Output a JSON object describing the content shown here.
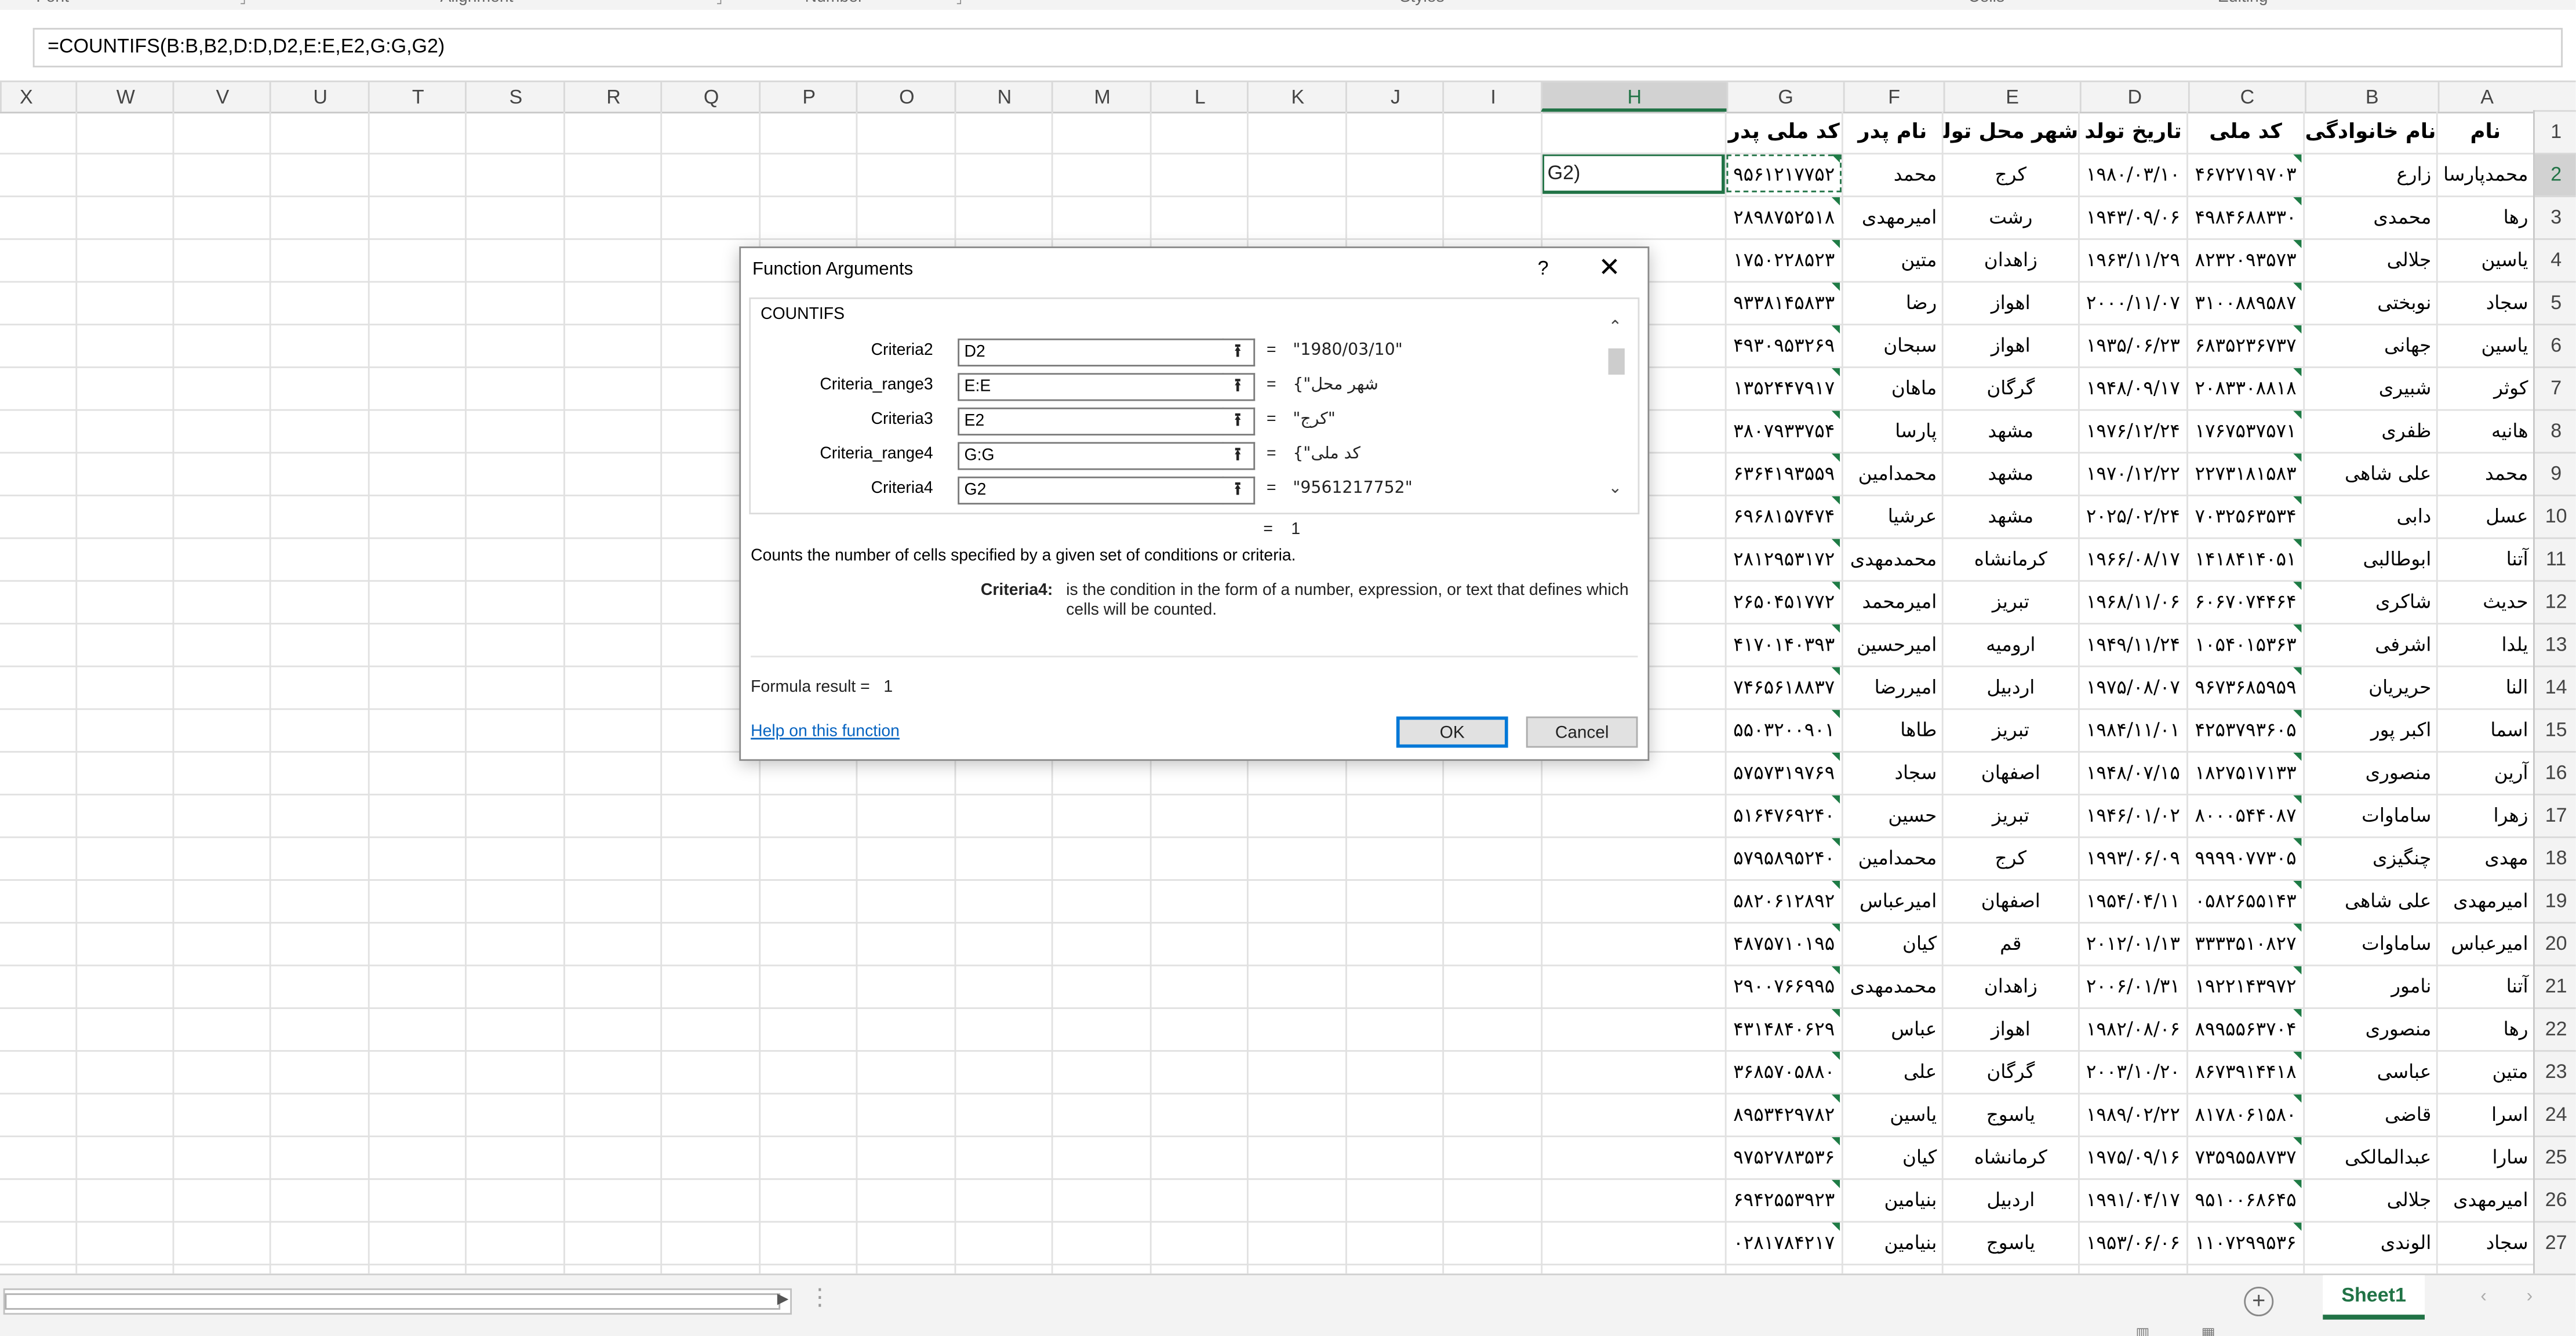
{
  "ribbon": {
    "groups": [
      "Font",
      "Alignment",
      "Number",
      "Styles",
      "Cells",
      "Editing"
    ]
  },
  "formula_bar": {
    "formula": "=COUNTIFS(B:B,B2,D:D,D2,E:E,E2,G:G,G2)"
  },
  "columns": [
    "X",
    "W",
    "V",
    "U",
    "T",
    "S",
    "R",
    "Q",
    "P",
    "O",
    "N",
    "M",
    "L",
    "K",
    "J",
    "I",
    "H",
    "G",
    "F",
    "E",
    "D",
    "C",
    "B",
    "A"
  ],
  "selected_column": "H",
  "selected_row": "2",
  "row_numbers": [
    "1",
    "2",
    "3",
    "4",
    "5",
    "6",
    "7",
    "8",
    "9",
    "10",
    "11",
    "12",
    "13",
    "14",
    "15",
    "16",
    "17",
    "18",
    "19",
    "20",
    "21",
    "22",
    "23",
    "24",
    "25",
    "26",
    "27"
  ],
  "headers": {
    "A": "نام",
    "B": "نام خانوادگی",
    "C": "کد ملی",
    "D": "تاریخ تولد",
    "E": "شهر محل تولد",
    "F": "نام پدر",
    "G": "کد ملی پدر"
  },
  "active_cell": {
    "ref": "H2",
    "text": "G2)"
  },
  "rows": [
    {
      "A": "محمدپارسا",
      "B": "زارع",
      "C": "۴۶۷۲۷۱۹۷۰۳",
      "D": "۱۹۸۰/۰۳/۱۰",
      "E": "کرج",
      "F": "محمد",
      "G": "۹۵۶۱۲۱۷۷۵۲"
    },
    {
      "A": "رها",
      "B": "محمدی",
      "C": "۴۹۸۴۶۸۸۳۳۰",
      "D": "۱۹۴۳/۰۹/۰۶",
      "E": "رشت",
      "F": "امیرمهدی",
      "G": "۲۸۹۸۷۵۲۵۱۸"
    },
    {
      "A": "یاسین",
      "B": "جلالی",
      "C": "۸۲۳۲۰۹۳۵۷۳",
      "D": "۱۹۶۳/۱۱/۲۹",
      "E": "زاهدان",
      "F": "متین",
      "G": "۱۷۵۰۲۲۸۵۲۳"
    },
    {
      "A": "سجاد",
      "B": "نوبختی",
      "C": "۳۱۰۰۸۸۹۵۸۷",
      "D": "۲۰۰۰/۱۱/۰۷",
      "E": "اهواز",
      "F": "رضا",
      "G": "۹۳۳۸۱۴۵۸۳۳"
    },
    {
      "A": "یاسین",
      "B": "جهانی",
      "C": "۶۸۳۵۲۳۶۷۳۷",
      "D": "۱۹۳۵/۰۶/۲۳",
      "E": "اهواز",
      "F": "سبحان",
      "G": "۴۹۳۰۹۵۳۲۶۹"
    },
    {
      "A": "کوثر",
      "B": "شبیری",
      "C": "۲۰۸۳۳۰۸۸۱۸",
      "D": "۱۹۴۸/۰۹/۱۷",
      "E": "گرگان",
      "F": "ماهان",
      "G": "۱۳۵۲۴۴۷۹۱۷"
    },
    {
      "A": "هانیه",
      "B": "ظفری",
      "C": "۱۷۶۷۵۳۷۵۷۱",
      "D": "۱۹۷۶/۱۲/۲۴",
      "E": "مشهد",
      "F": "پارسا",
      "G": "۳۸۰۷۹۳۳۷۵۴"
    },
    {
      "A": "محمد",
      "B": "علی شاهی",
      "C": "۲۲۷۳۱۸۱۵۸۳",
      "D": "۱۹۷۰/۱۲/۲۲",
      "E": "مشهد",
      "F": "محمدامین",
      "G": "۶۳۶۴۱۹۳۵۵۹"
    },
    {
      "A": "عسل",
      "B": "دابی",
      "C": "۷۰۳۲۵۶۳۵۳۴",
      "D": "۲۰۲۵/۰۲/۲۴",
      "E": "مشهد",
      "F": "عرشیا",
      "G": "۶۹۶۸۱۵۷۴۷۴"
    },
    {
      "A": "آتنا",
      "B": "ابوطالبی",
      "C": "۱۴۱۸۴۱۴۰۵۱",
      "D": "۱۹۶۶/۰۸/۱۷",
      "E": "کرمانشاه",
      "F": "محمدمهدی",
      "G": "۲۸۱۲۹۵۳۱۷۲"
    },
    {
      "A": "حدیث",
      "B": "شاکری",
      "C": "۶۰۶۷۰۷۴۴۶۴",
      "D": "۱۹۶۸/۱۱/۰۶",
      "E": "تبریز",
      "F": "امیرمحمد",
      "G": "۲۶۵۰۴۵۱۷۷۲"
    },
    {
      "A": "یلدا",
      "B": "اشرفی",
      "C": "۱۰۵۴۰۱۵۳۶۳",
      "D": "۱۹۴۹/۱۱/۲۴",
      "E": "ارومیه",
      "F": "امیرحسین",
      "G": "۴۱۷۰۱۴۰۳۹۳"
    },
    {
      "A": "النا",
      "B": "حریریان",
      "C": "۹۶۷۳۶۸۵۹۵۹",
      "D": "۱۹۷۵/۰۸/۰۷",
      "E": "اردبیل",
      "F": "امیررضا",
      "G": "۷۴۶۵۶۱۸۸۳۷"
    },
    {
      "A": "اسما",
      "B": "اکبر پور",
      "C": "۴۲۵۳۷۹۳۶۰۵",
      "D": "۱۹۸۴/۱۱/۰۱",
      "E": "تبریز",
      "F": "طاها",
      "G": "۵۵۰۳۲۰۰۹۰۱"
    },
    {
      "A": "آرین",
      "B": "منصوری",
      "C": "۱۸۲۷۵۱۷۱۳۳",
      "D": "۱۹۴۸/۰۷/۱۵",
      "E": "اصفهان",
      "F": "سجاد",
      "G": "۵۷۵۷۳۱۹۷۶۹"
    },
    {
      "A": "زهرا",
      "B": "ساماوات",
      "C": "۸۰۰۰۵۴۴۰۸۷",
      "D": "۱۹۴۶/۰۱/۰۲",
      "E": "تبریز",
      "F": "حسین",
      "G": "۵۱۶۴۷۶۹۲۴۰"
    },
    {
      "A": "مهدی",
      "B": "چنگیزی",
      "C": "۹۹۹۹۰۷۷۳۰۵",
      "D": "۱۹۹۳/۰۶/۰۹",
      "E": "کرج",
      "F": "محمدامین",
      "G": "۵۷۹۵۸۹۵۲۴۰"
    },
    {
      "A": "امیرمهدی",
      "B": "علی شاهی",
      "C": "۰۵۸۲۶۵۵۱۴۳",
      "D": "۱۹۵۴/۰۴/۱۱",
      "E": "اصفهان",
      "F": "امیرعباس",
      "G": "۵۸۲۰۶۱۲۸۹۲"
    },
    {
      "A": "امیرعباس",
      "B": "ساماوات",
      "C": "۳۳۳۳۵۱۰۸۲۷",
      "D": "۲۰۱۲/۰۱/۱۳",
      "E": "قم",
      "F": "کیان",
      "G": "۴۸۷۵۷۱۰۱۹۵"
    },
    {
      "A": "آتنا",
      "B": "نامور",
      "C": "۱۹۲۲۱۴۳۹۷۲",
      "D": "۲۰۰۶/۰۱/۳۱",
      "E": "زاهدان",
      "F": "محمدمهدی",
      "G": "۲۹۰۰۷۶۶۹۹۵"
    },
    {
      "A": "رها",
      "B": "منصوری",
      "C": "۸۹۹۵۵۶۳۷۰۴",
      "D": "۱۹۸۲/۰۸/۰۶",
      "E": "اهواز",
      "F": "عباس",
      "G": "۴۳۱۴۸۴۰۶۲۹"
    },
    {
      "A": "متین",
      "B": "عباسی",
      "C": "۸۶۷۳۹۱۴۴۱۸",
      "D": "۲۰۰۳/۱۰/۲۰",
      "E": "گرگان",
      "F": "علی",
      "G": "۳۶۸۵۷۰۵۸۸۰"
    },
    {
      "A": "اسرا",
      "B": "قاضی",
      "C": "۸۱۷۸۰۶۱۵۸۰",
      "D": "۱۹۸۹/۰۲/۲۲",
      "E": "یاسوج",
      "F": "یاسین",
      "G": "۸۹۵۳۴۲۹۷۸۲"
    },
    {
      "A": "سارا",
      "B": "عبدالمالکی",
      "C": "۷۳۵۹۵۵۸۷۳۷",
      "D": "۱۹۷۵/۰۹/۱۶",
      "E": "کرمانشاه",
      "F": "کیان",
      "G": "۹۷۵۲۷۸۳۵۳۶"
    },
    {
      "A": "امیرمهدی",
      "B": "جلالی",
      "C": "۹۵۱۰۰۶۸۶۴۵",
      "D": "۱۹۹۱/۰۴/۱۷",
      "E": "اردبیل",
      "F": "بنیامین",
      "G": "۶۹۴۲۵۵۳۹۲۳"
    },
    {
      "A": "سجاد",
      "B": "الوندی",
      "C": "۱۱۰۷۲۹۹۵۳۶",
      "D": "۱۹۵۳/۰۶/۰۶",
      "E": "یاسوج",
      "F": "بنیامین",
      "G": "۰۲۸۱۷۸۴۲۱۷"
    }
  ],
  "dialog": {
    "title": "Function Arguments",
    "help_glyph": "?",
    "close_glyph": "✕",
    "function_name": "COUNTIFS",
    "args": [
      {
        "label": "Criteria2",
        "value": "D2",
        "result": "\"1980/03/10\""
      },
      {
        "label": "Criteria_range3",
        "value": "E:E",
        "result": "{\"شهر محل"
      },
      {
        "label": "Criteria3",
        "value": "E2",
        "result": "\"کرج\""
      },
      {
        "label": "Criteria_range4",
        "value": "G:G",
        "result": "{\"کد ملی"
      },
      {
        "label": "Criteria4",
        "value": "G2",
        "result": "\"9561217752\""
      }
    ],
    "eq": "=",
    "total": "1",
    "description": "Counts the number of cells specified by a given set of conditions or criteria.",
    "criteria_label": "Criteria4:",
    "criteria_text": "is the condition in the form of a number, expression, or text that defines which cells will be counted.",
    "formula_result_label": "Formula result =",
    "formula_result_value": "1",
    "help_link": "Help on this function",
    "ok": "OK",
    "cancel": "Cancel"
  },
  "sheet": {
    "tab": "Sheet1"
  },
  "colors": {
    "accent": "#217346",
    "link": "#0563c1",
    "ok_border": "#0078d7"
  }
}
